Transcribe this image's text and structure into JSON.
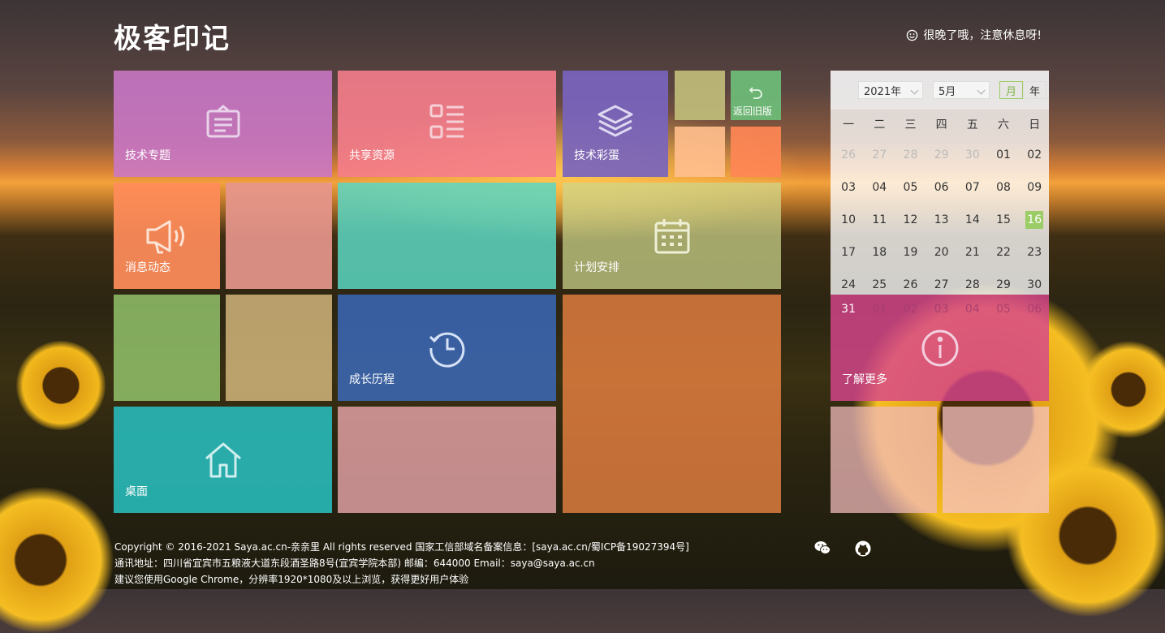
{
  "header": {
    "title": "极客印记",
    "message": "很晚了哦，注意休息呀!"
  },
  "tiles": {
    "tech_topics": "技术专题",
    "shared_resources": "共享资源",
    "tech_easter_egg": "技术彩蛋",
    "back_old_version": "返回旧版",
    "news": "消息动态",
    "plan": "计划安排",
    "growth": "成长历程",
    "desktop": "桌面",
    "learn_more": "了解更多"
  },
  "calendar": {
    "year": "2021年",
    "month": "5月",
    "mode_month": "月",
    "mode_year": "年",
    "weekdays": [
      "一",
      "二",
      "三",
      "四",
      "五",
      "六",
      "日"
    ],
    "weeks": [
      [
        "26",
        "27",
        "28",
        "29",
        "30",
        "01",
        "02"
      ],
      [
        "03",
        "04",
        "05",
        "06",
        "07",
        "08",
        "09"
      ],
      [
        "10",
        "11",
        "12",
        "13",
        "14",
        "15",
        "16"
      ],
      [
        "17",
        "18",
        "19",
        "20",
        "21",
        "22",
        "23"
      ],
      [
        "24",
        "25",
        "26",
        "27",
        "28",
        "29",
        "30"
      ]
    ],
    "last_row": [
      "31",
      "01",
      "02",
      "03",
      "04",
      "05",
      "06"
    ],
    "today": "16"
  },
  "footer": {
    "line1": "Copyright © 2016-2021 Saya.ac.cn-亲亲里 All rights reserved 国家工信部域名备案信息：[saya.ac.cn/蜀ICP备19027394号]",
    "line2": "通讯地址：四川省宜宾市五粮液大道东段酒圣路8号(宜宾学院本部) 邮编：644000 Email：saya@saya.ac.cn",
    "line3": "建议您使用Google Chrome，分辨率1920*1080及以上浏览，获得更好用户体验"
  },
  "icons": {
    "wechat": "wechat-icon",
    "github": "github-icon"
  }
}
